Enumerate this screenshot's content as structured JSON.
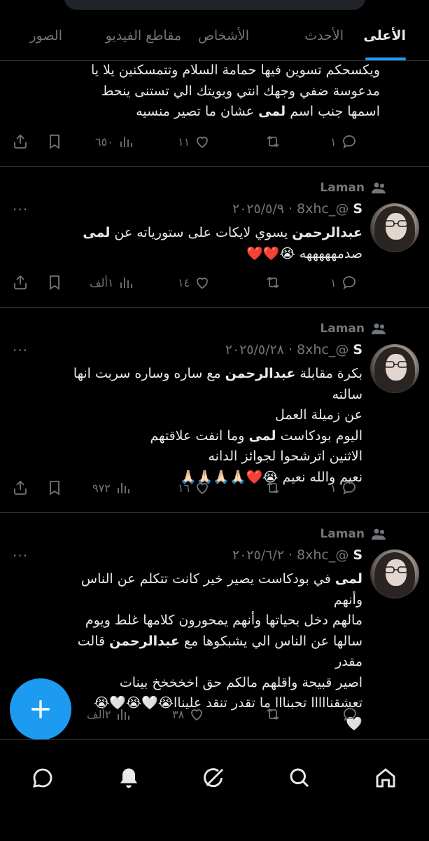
{
  "tabs": [
    {
      "label": "الأعلى",
      "active": true
    },
    {
      "label": "الأحدث",
      "active": false
    },
    {
      "label": "الأشخاص",
      "active": false
    },
    {
      "label": "مقاطع الفيديو",
      "active": false
    },
    {
      "label": "الصور",
      "active": false
    }
  ],
  "tweet0": {
    "line1": "ويكسحكم تسوين فيها حمامة السلام وتتمسكنين يلا يا",
    "line2": "مدعوسة ضفي وجهك انتي وبويتك الي تستنى ينحط",
    "line3_a": "اسمها جنب اسم ",
    "line3_b": "لمى",
    "line3_c": " عشان ما تصير منسيه",
    "replies": "١",
    "likes": "١١",
    "views": "٦٥٠"
  },
  "tweet1": {
    "social": "Laman",
    "name": "S",
    "handle": "@_8xhc",
    "date": "٢٠٢٥/٥/٩",
    "more": "···",
    "l1_a": "عبدالرحمن",
    "l1_b": " يسوي لايكات على ستورياته عن ",
    "l1_c": "لمى",
    "l2": "صدمهههههه 😭❤️❤️",
    "replies": "١",
    "likes": "١٤",
    "views": "١ألف"
  },
  "tweet2": {
    "social": "Laman",
    "name": "S",
    "handle": "@_8xhc",
    "date": "٢٠٢٥/٥/٢٨",
    "more": "···",
    "l1_a": "بكرة مقابلة ",
    "l1_b": "عبدالرحمن",
    "l1_c": " مع ساره وساره سربت انها سالته",
    "l2": "عن زميلة العمل",
    "l3_a": "اليوم بودكاست ",
    "l3_b": "لمى",
    "l3_c": " وما انفت علاقتهم",
    "l4": "الاثنين اترشحوا لجوائز الدانه",
    "l5": "نعيم والله نعيم 😭❤️🙏🏻🙏🏻🙏🏻🙏🏻",
    "replies": "١",
    "likes": "١٦",
    "views": "٩٧٢"
  },
  "tweet3": {
    "social": "Laman",
    "name": "S",
    "handle": "@_8xhc",
    "date": "٢٠٢٥/٦/٢",
    "more": "···",
    "l1_a": "لمى",
    "l1_b": " في بودكاست يصير خير كانت تتكلم عن الناس وأنهم",
    "l2": "مالهم دخل بحياتها وأنهم يمحورون كلامها غلط ويوم",
    "l3_a": "سالها عن الناس الي يشبكوها مع ",
    "l3_b": "عبدالرحمن",
    "l3_c": " قالت مقدر",
    "l4": "اصير قبيحة واقلهم مالكم حق اخخخخخ بينات",
    "l5": "تعشقنااااا تحبنااا ما تقدر تنقد عليناا😭🤍😭🤍😭",
    "l6": "🤍",
    "likes": "٣٨",
    "views": "٢ألف"
  },
  "colors": {
    "accent": "#1d9bf0",
    "muted": "#71767b",
    "text": "#e7e9ea",
    "divider": "#2f3336"
  },
  "nav_icons": [
    "messages-icon",
    "notifications-icon",
    "grok-icon",
    "search-icon",
    "home-icon"
  ]
}
